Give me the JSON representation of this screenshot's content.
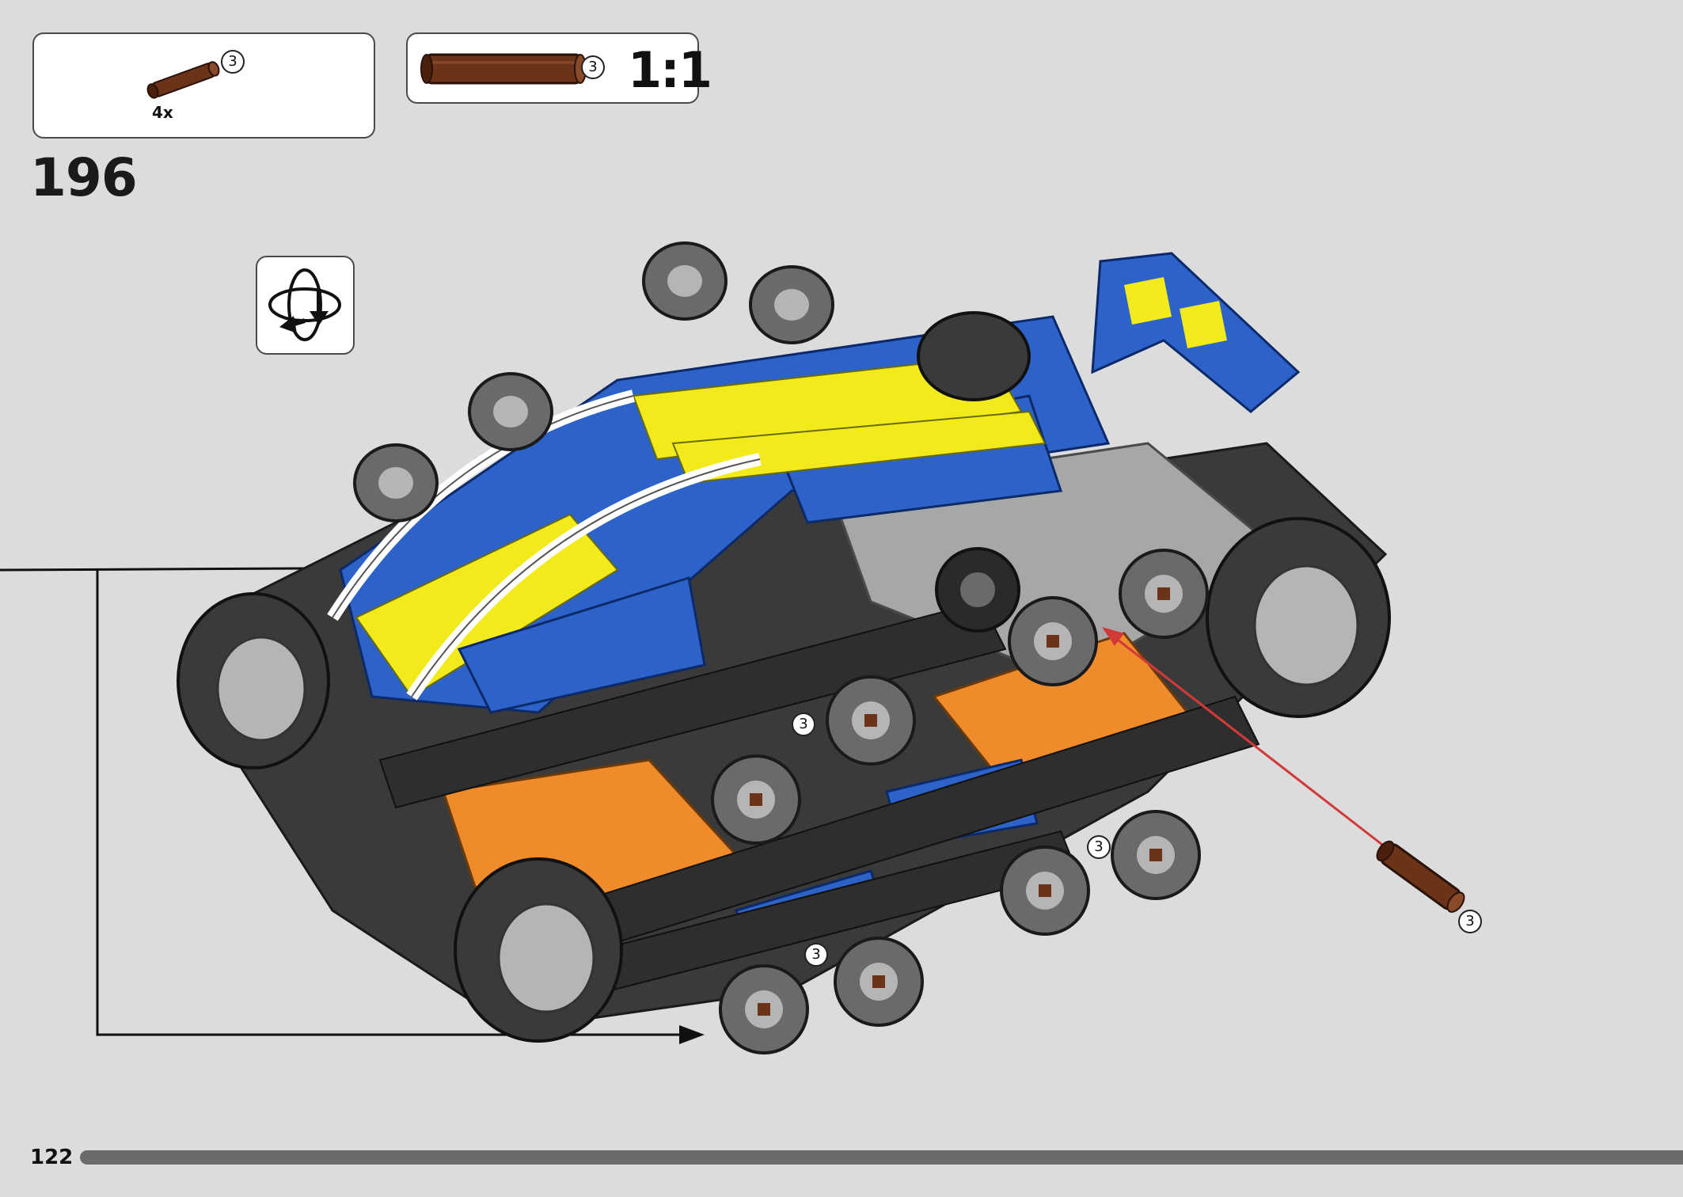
{
  "parts_list": {
    "quantity": "4x",
    "part_length": "3"
  },
  "scale_reference": {
    "part_length": "3",
    "scale_label": "1:1"
  },
  "step": {
    "number": "196",
    "rotate_icon": "rotate-model-icon"
  },
  "callouts": {
    "axle_length_a": "3",
    "axle_length_b": "3",
    "axle_length_c": "3",
    "axle_length_d": "3"
  },
  "footer": {
    "page_number": "122",
    "progress": 1.0
  },
  "colors": {
    "background": "#dcdcdc",
    "axle_brown": "#6b3318",
    "blue": "#2d63c8",
    "yellow": "#f3ea1c",
    "orange": "#f08b2c",
    "dark_gray": "#3a3a3a",
    "light_gray": "#a7a7a7",
    "red_arrow": "#d23a3a"
  }
}
